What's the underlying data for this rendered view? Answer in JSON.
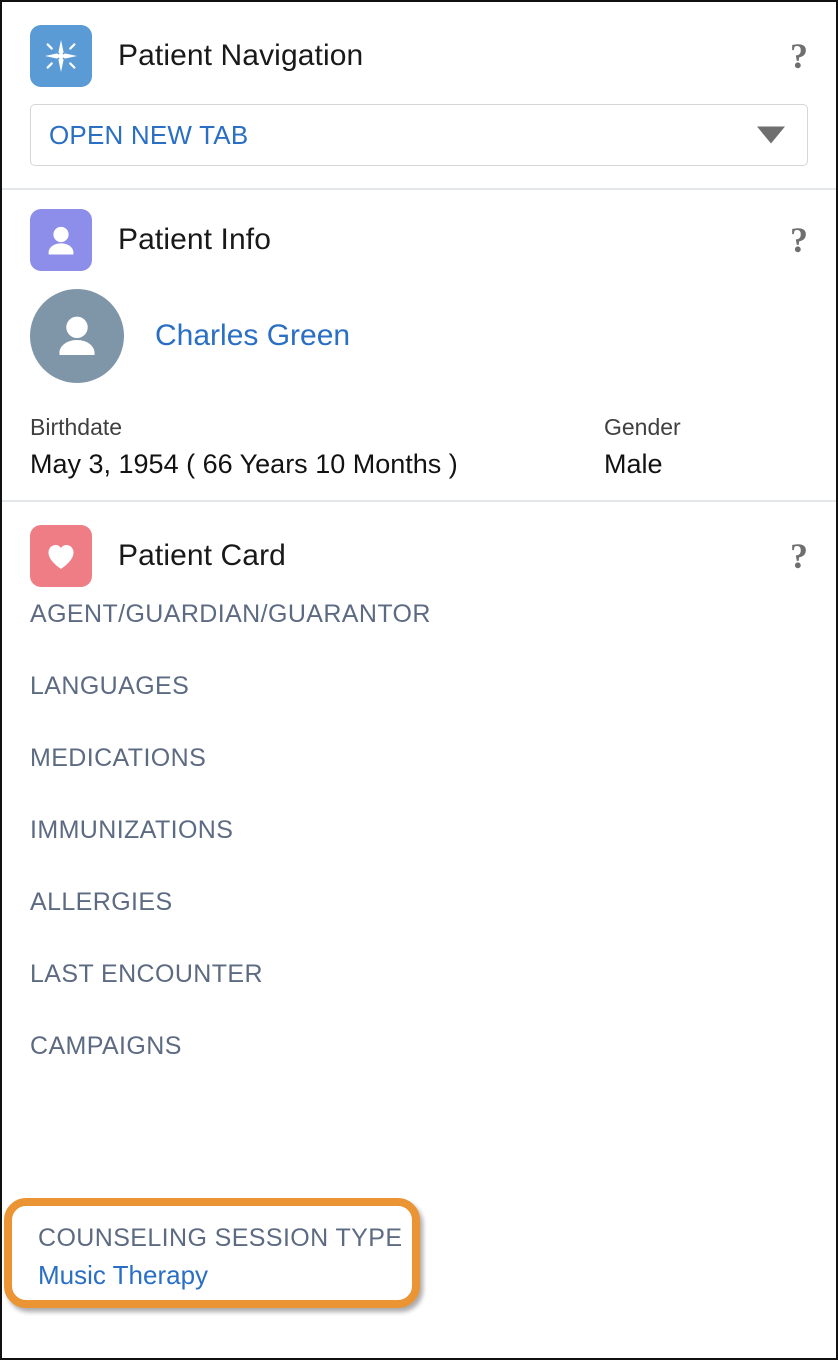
{
  "navigation": {
    "title": "Patient Navigation",
    "icon": "compass-star-icon",
    "icon_color": "#5b9bd5",
    "help_label": "?",
    "dropdown": {
      "value": "OPEN NEW TAB",
      "caret": "chevron-down-icon"
    }
  },
  "patient_info": {
    "title": "Patient Info",
    "icon": "person-icon",
    "icon_color": "#8d8ee9",
    "help_label": "?",
    "avatar": "avatar-person-icon",
    "avatar_color": "#7f95a8",
    "name": "Charles Green",
    "fields": [
      {
        "label": "Birthdate",
        "value": "May 3, 1954 ( 66 Years 10 Months )"
      },
      {
        "label": "Gender",
        "value": "Male"
      }
    ]
  },
  "patient_card": {
    "title": "Patient Card",
    "icon": "heart-icon",
    "icon_color": "#ef7d86",
    "help_label": "?",
    "items": [
      {
        "label": "AGENT/GUARDIAN/GUARANTOR",
        "value": ""
      },
      {
        "label": "LANGUAGES",
        "value": ""
      },
      {
        "label": "MEDICATIONS",
        "value": ""
      },
      {
        "label": "IMMUNIZATIONS",
        "value": ""
      },
      {
        "label": "ALLERGIES",
        "value": ""
      },
      {
        "label": "LAST ENCOUNTER",
        "value": ""
      },
      {
        "label": "CAMPAIGNS",
        "value": ""
      }
    ],
    "highlighted_item": {
      "label": "COUNSELING SESSION TYPE",
      "value": "Music Therapy",
      "highlight_color": "#eb9434"
    }
  },
  "colors": {
    "link": "#2a6fc3",
    "muted_label": "#5d6b82",
    "divider": "#e4e7ea",
    "frame_border": "#111111"
  }
}
